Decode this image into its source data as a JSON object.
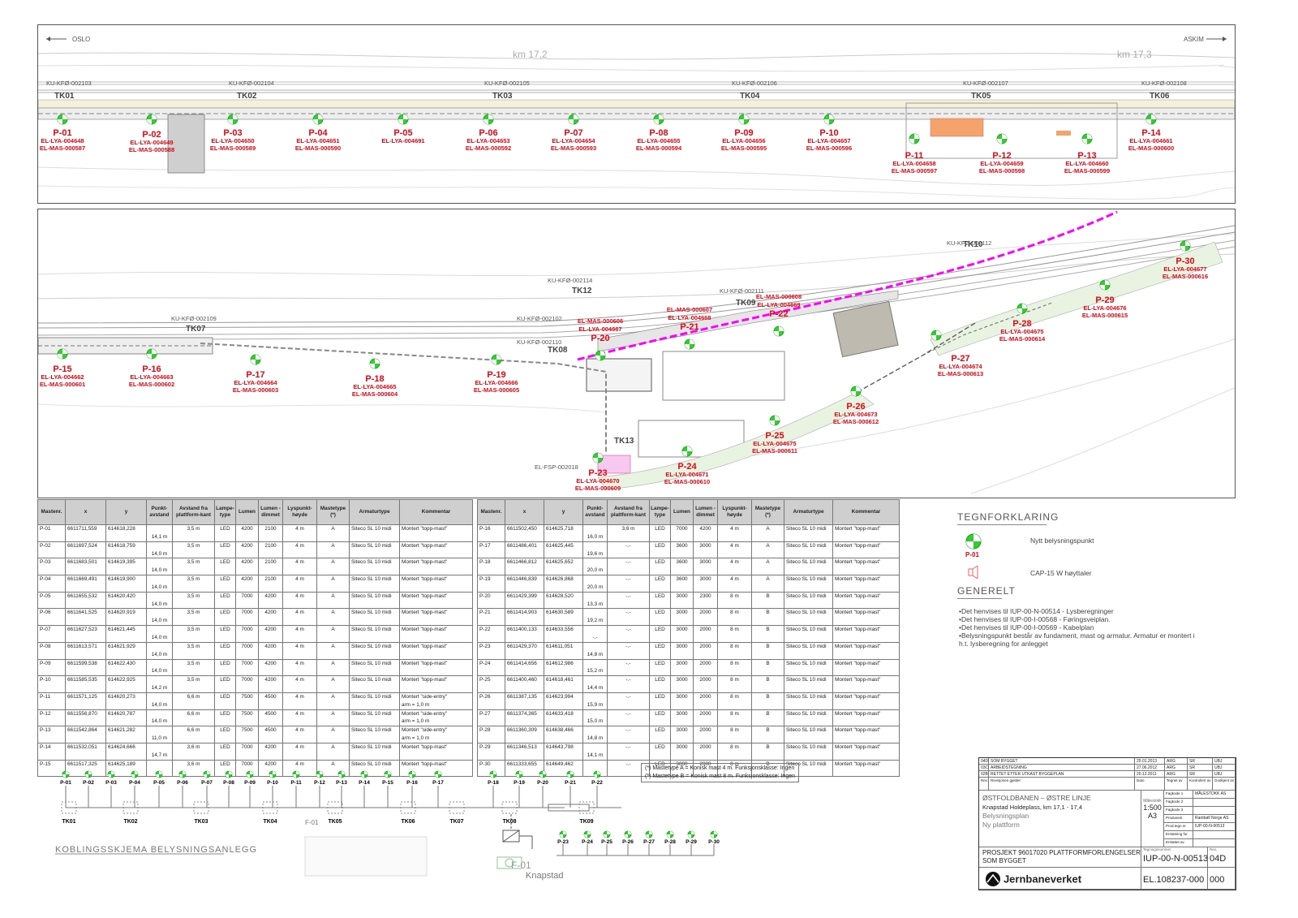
{
  "plan_top": {
    "direction_left": "OSLO",
    "direction_right": "ASKIM",
    "km_labels": [
      "km 17,2",
      "km 17,3"
    ],
    "track_labels": [
      "TK01",
      "TK02",
      "TK03",
      "TK04",
      "TK05",
      "TK06"
    ],
    "ku_labels": [
      "KU-KFØ-002103",
      "KU-KFØ-002104",
      "KU-KFØ-002105",
      "KU-KFØ-002106",
      "KU-KFØ-002107",
      "KU-KFØ-002108"
    ],
    "points": [
      {
        "id": "P-01",
        "lya": "EL-LYA-004648",
        "mas": "EL-MAS-000587"
      },
      {
        "id": "P-02",
        "lya": "EL-LYA-004649",
        "mas": "EL-MAS-000588"
      },
      {
        "id": "P-03",
        "lya": "EL-LYA-004650",
        "mas": "EL-MAS-000589"
      },
      {
        "id": "P-04",
        "lya": "EL-LYA-004651",
        "mas": "EL-MAS-000590"
      },
      {
        "id": "P-05",
        "lya": "EL-LYA-004691",
        "mas": ""
      },
      {
        "id": "P-06",
        "lya": "EL-LYA-004653",
        "mas": "EL-MAS-000592"
      },
      {
        "id": "P-07",
        "lya": "EL-LYA-004654",
        "mas": "EL-MAS-000593"
      },
      {
        "id": "P-08",
        "lya": "EL-LYA-004655",
        "mas": "EL-MAS-000594"
      },
      {
        "id": "P-09",
        "lya": "EL-LYA-004656",
        "mas": "EL-MAS-000595"
      },
      {
        "id": "P-10",
        "lya": "EL-LYA-004657",
        "mas": "EL-MAS-000596"
      },
      {
        "id": "P-11",
        "lya": "EL-LYA-004658",
        "mas": "EL-MAS-000597"
      },
      {
        "id": "P-12",
        "lya": "EL-LYA-004659",
        "mas": "EL-MAS-000598"
      },
      {
        "id": "P-13",
        "lya": "EL-LYA-004660",
        "mas": "EL-MAS-000599"
      },
      {
        "id": "P-14",
        "lya": "EL-LYA-004661",
        "mas": "EL-MAS-000600"
      }
    ]
  },
  "plan_bottom": {
    "track_labels": [
      "TK07",
      "TK08",
      "TK09",
      "TK10",
      "TK12",
      "TK13"
    ],
    "ku_labels": [
      "KU-KFØ-002109",
      "KU-KFØ-002102",
      "KU-KFØ-002110",
      "KU-KFØ-002111",
      "KU-KFØ-002112",
      "KU-KFØ-002114"
    ],
    "fsp_label": "EL-FSP-002018",
    "points": [
      {
        "id": "P-15",
        "lya": "EL-LYA-004662",
        "mas": "EL-MAS-000601"
      },
      {
        "id": "P-16",
        "lya": "EL-LYA-004663",
        "mas": "EL-MAS-000602"
      },
      {
        "id": "P-17",
        "lya": "EL-LYA-004664",
        "mas": "EL-MAS-000603"
      },
      {
        "id": "P-18",
        "lya": "EL-LYA-004665",
        "mas": "EL-MAS-000604"
      },
      {
        "id": "P-19",
        "lya": "EL-LYA-004666",
        "mas": "EL-MAS-000605"
      },
      {
        "id": "P-20",
        "lya": "EL-LYA-004667",
        "mas": "EL-MAS-000606"
      },
      {
        "id": "P-21",
        "lya": "EL-LYA-004668",
        "mas": "EL-MAS-000607"
      },
      {
        "id": "P-22",
        "lya": "EL-LYA-004669",
        "mas": "EL-MAS-000608"
      },
      {
        "id": "P-23",
        "lya": "EL-LYA-004670",
        "mas": "EL-MAS-000609"
      },
      {
        "id": "P-24",
        "lya": "EL-LYA-004671",
        "mas": "EL-MAS-000610"
      },
      {
        "id": "P-25",
        "lya": "EL-LYA-004675",
        "mas": "EL-MAS-000611"
      },
      {
        "id": "P-26",
        "lya": "EL-LYA-004673",
        "mas": "EL-MAS-000612"
      },
      {
        "id": "P-27",
        "lya": "EL-LYA-004674",
        "mas": "EL-MAS-000613"
      },
      {
        "id": "P-28",
        "lya": "EL-LYA-004675",
        "mas": "EL-MAS-000614"
      },
      {
        "id": "P-29",
        "lya": "EL-LYA-004676",
        "mas": "EL-MAS-000615"
      },
      {
        "id": "P-30",
        "lya": "EL-LYA-004677",
        "mas": "EL-MAS-000616"
      }
    ]
  },
  "table_headers": [
    "Mastenr.",
    "x",
    "y",
    "Punkt-avstand",
    "Avstand fra plattform-kant",
    "Lampe-type",
    "Lumen",
    "Lumen - dimmet",
    "Lyspunkt-høyde",
    "Mastetype (*)",
    "Armaturtype",
    "Kommentar"
  ],
  "table_left": [
    {
      "r": [
        "P-01",
        "6611711,559",
        "614618,228",
        "",
        "3,5 m",
        "LED",
        "4200",
        "2100",
        "4 m",
        "A",
        "Siteco SL 10 midi",
        "Montert \"topp-mast\""
      ],
      "d": "14,1 m",
      "c2": ""
    },
    {
      "r": [
        "P-02",
        "6611697,524",
        "614618,759",
        "",
        "3,5 m",
        "LED",
        "4200",
        "2100",
        "4 m",
        "A",
        "Siteco SL 10 midi",
        "Montert \"topp-mast\""
      ],
      "d": "14,0 m",
      "c2": ""
    },
    {
      "r": [
        "P-03",
        "6611683,501",
        "614619,395",
        "",
        "3,5 m",
        "LED",
        "4200",
        "2100",
        "4 m",
        "A",
        "Siteco SL 10 midi",
        "Montert \"topp-mast\""
      ],
      "d": "14,0 m",
      "c2": ""
    },
    {
      "r": [
        "P-04",
        "6611669,491",
        "614619,900",
        "",
        "3,5 m",
        "LED",
        "4200",
        "2100",
        "4 m",
        "A",
        "Siteco SL 10 midi",
        "Montert \"topp-mast\""
      ],
      "d": "14,0 m",
      "c2": ""
    },
    {
      "r": [
        "P-05",
        "6611655,532",
        "614620,420",
        "",
        "3,5 m",
        "LED",
        "7000",
        "4200",
        "4 m",
        "A",
        "Siteco SL 10 midi",
        "Montert \"topp-mast\""
      ],
      "d": "14,0 m",
      "c2": ""
    },
    {
      "r": [
        "P-06",
        "6611641,525",
        "614620,919",
        "",
        "3,5 m",
        "LED",
        "7000",
        "4200",
        "4 m",
        "A",
        "Siteco SL 10 midi",
        "Montert \"topp-mast\""
      ],
      "d": "14,0 m",
      "c2": ""
    },
    {
      "r": [
        "P-07",
        "6611627,523",
        "614621,445",
        "",
        "3,5 m",
        "LED",
        "7000",
        "4200",
        "4 m",
        "A",
        "Siteco SL 10 midi",
        "Montert \"topp-mast\""
      ],
      "d": "14,0 m",
      "c2": ""
    },
    {
      "r": [
        "P-08",
        "6611613,571",
        "614621,929",
        "",
        "3,5 m",
        "LED",
        "7000",
        "4200",
        "4 m",
        "A",
        "Siteco SL 10 midi",
        "Montert \"topp-mast\""
      ],
      "d": "14,0 m",
      "c2": ""
    },
    {
      "r": [
        "P-09",
        "6611599,538",
        "614622,430",
        "",
        "3,5 m",
        "LED",
        "7000",
        "4200",
        "4 m",
        "A",
        "Siteco SL 10 midi",
        "Montert \"topp-mast\""
      ],
      "d": "14,0 m",
      "c2": ""
    },
    {
      "r": [
        "P-10",
        "6611585,535",
        "614622,925",
        "",
        "3,5 m",
        "LED",
        "7000",
        "4200",
        "4 m",
        "A",
        "Siteco SL 10 midi",
        "Montert \"topp-mast\""
      ],
      "d": "14,2 m",
      "c2": ""
    },
    {
      "r": [
        "P-11",
        "6611571,125",
        "614620,273",
        "",
        "6,6 m",
        "LED",
        "7500",
        "4500",
        "4 m",
        "A",
        "Siteco SL 10 midi",
        "Montert \"side-entry\""
      ],
      "d": "14,0 m",
      "c2": "arm = 1,0 m"
    },
    {
      "r": [
        "P-12",
        "6611556,870",
        "614620,787",
        "",
        "6,6 m",
        "LED",
        "7500",
        "4500",
        "4 m",
        "A",
        "Siteco SL 10 midi",
        "Montert \"side-entry\""
      ],
      "d": "14,0 m",
      "c2": "arm = 1,0 m"
    },
    {
      "r": [
        "P-13",
        "6611542,864",
        "614621,282",
        "",
        "6,6 m",
        "LED",
        "7500",
        "4500",
        "4 m",
        "A",
        "Siteco SL 10 midi",
        "Montert \"side-entry\""
      ],
      "d": "11,0 m",
      "c2": "arm = 1,0 m"
    },
    {
      "r": [
        "P-14",
        "6611532,051",
        "614624,666",
        "",
        "3,6 m",
        "LED",
        "7000",
        "4200",
        "4 m",
        "A",
        "Siteco SL 10 midi",
        "Montert \"topp-mast\""
      ],
      "d": "14,7 m",
      "c2": ""
    },
    {
      "r": [
        "P-15",
        "6611517,325",
        "614625,189",
        "",
        "3,6 m",
        "LED",
        "7000",
        "4200",
        "4 m",
        "A",
        "Siteco SL 10 midi",
        "Montert \"topp-mast\""
      ],
      "d": "",
      "c2": ""
    }
  ],
  "table_right": [
    {
      "r": [
        "P-16",
        "6611502,450",
        "614625,718",
        "",
        "3,6 m",
        "LED",
        "7000",
        "4200",
        "4 m",
        "A",
        "Siteco SL 10 midi",
        "Montert \"topp-mast\""
      ],
      "d": "16,0 m",
      "c2": ""
    },
    {
      "r": [
        "P-17",
        "6611486,401",
        "614625,445",
        "",
        "-.-",
        "LED",
        "3600",
        "3000",
        "4 m",
        "A",
        "Siteco SL 10 midi",
        "Montert \"topp-mast\""
      ],
      "d": "19,6 m",
      "c2": ""
    },
    {
      "r": [
        "P-18",
        "6611466,812",
        "614625,652",
        "",
        "-.-",
        "LED",
        "3600",
        "3000",
        "4 m",
        "A",
        "Siteco SL 10 midi",
        "Montert \"topp-mast\""
      ],
      "d": "20,0 m",
      "c2": ""
    },
    {
      "r": [
        "P-19",
        "6611446,839",
        "614626,868",
        "",
        "-.-",
        "LED",
        "3600",
        "3000",
        "4 m",
        "A",
        "Siteco SL 10 midi",
        "Montert \"topp-mast\""
      ],
      "d": "20,0 m",
      "c2": ""
    },
    {
      "r": [
        "P-20",
        "6611429,399",
        "614628,520",
        "",
        "-.-",
        "LED",
        "3000",
        "2300",
        "8 m",
        "B",
        "Siteco SL 10 midi",
        "Montert \"topp-mast\""
      ],
      "d": "13,3 m",
      "c2": ""
    },
    {
      "r": [
        "P-21",
        "6611414,903",
        "614630,589",
        "",
        "-.-",
        "LED",
        "3000",
        "2000",
        "8 m",
        "B",
        "Siteco SL 10 midi",
        "Montert \"topp-mast\""
      ],
      "d": "19,2 m",
      "c2": ""
    },
    {
      "r": [
        "P-22",
        "6611400,133",
        "614633,556",
        "",
        "-.-",
        "LED",
        "3000",
        "2000",
        "8 m",
        "B",
        "Siteco SL 10 midi",
        "Montert \"topp-mast\""
      ],
      "d": "-.-",
      "c2": ""
    },
    {
      "r": [
        "P-23",
        "6611429,370",
        "614611,051",
        "",
        "-.-",
        "LED",
        "3000",
        "2000",
        "8 m",
        "B",
        "Siteco SL 10 midi",
        "Montert \"topp-mast\""
      ],
      "d": "14,8 m",
      "c2": ""
    },
    {
      "r": [
        "P-24",
        "6611414,656",
        "614612,986",
        "",
        "-.-",
        "LED",
        "3000",
        "2000",
        "8 m",
        "B",
        "Siteco SL 10 midi",
        "Montert \"topp-mast\""
      ],
      "d": "15,2 m",
      "c2": ""
    },
    {
      "r": [
        "P-25",
        "6611400,460",
        "614618,461",
        "",
        "-.-",
        "LED",
        "3000",
        "2000",
        "8 m",
        "B",
        "Siteco SL 10 midi",
        "Montert \"topp-mast\""
      ],
      "d": "14,4 m",
      "c2": ""
    },
    {
      "r": [
        "P-26",
        "6611387,135",
        "614623,994",
        "",
        "-.-",
        "LED",
        "3000",
        "2000",
        "8 m",
        "B",
        "Siteco SL 10 midi",
        "Montert \"topp-mast\""
      ],
      "d": "15,9 m",
      "c2": ""
    },
    {
      "r": [
        "P-27",
        "6611374,365",
        "614633,418",
        "",
        "-.-",
        "LED",
        "3000",
        "2000",
        "8 m",
        "B",
        "Siteco SL 10 midi",
        "Montert \"topp-mast\""
      ],
      "d": "15,0 m",
      "c2": ""
    },
    {
      "r": [
        "P-28",
        "6611360,309",
        "614638,466",
        "",
        "-.-",
        "LED",
        "3000",
        "2000",
        "8 m",
        "B",
        "Siteco SL 10 midi",
        "Montert \"topp-mast\""
      ],
      "d": "14,8 m",
      "c2": ""
    },
    {
      "r": [
        "P-29",
        "6611346,513",
        "614643,798",
        "",
        "-.-",
        "LED",
        "3000",
        "2000",
        "8 m",
        "B",
        "Siteco SL 10 midi",
        "Montert \"topp-mast\""
      ],
      "d": "14,1 m",
      "c2": ""
    },
    {
      "r": [
        "P-30",
        "6611333,655",
        "614649,462",
        "",
        "-.-",
        "LED",
        "3000",
        "2000",
        "8 m",
        "B",
        "Siteco SL 10 midi",
        "Montert \"topp-mast\""
      ],
      "d": "",
      "c2": ""
    }
  ],
  "legend": {
    "title": "TEGNFORKLARING",
    "new_point": "Nytt belysningspunkt",
    "sample_id": "P-01",
    "speaker": "CAP-15 W høyttaler",
    "general_title": "GENERELT",
    "general_items": [
      "•Det henvises til IUP-00-N-00514 - Lysberegninger",
      "•Det henvises til IUP-00-I-00568 - Føringsveiplan.",
      "•Det henvises til IUP-00-I-00569 - Kabelplan",
      "•Belysningspunkt består av fundament, mast og armatur. Armatur er montert i",
      "h.t. lysberegning for anlegget"
    ]
  },
  "mast_notes": [
    "(*) Mastetype A = Konisk mast 4 m. Funksjonsklasse: Ingen",
    "(*) Mastetype B = Konisk mast 8 m. Funksjonsklasse: Ingen"
  ],
  "schema": {
    "title": "KOBLINGSSKJEMA BELYSNINGSANLEGG",
    "f01": "F-01",
    "f01b": "F-01",
    "knapstad": "Knapstad",
    "points_row1": [
      "P-01",
      "P-02",
      "P-03",
      "P-04",
      "P-05",
      "P-06",
      "P-07",
      "P-08",
      "P-09",
      "P-10",
      "P-11",
      "P-12",
      "P-13",
      "P-14",
      "P-15",
      "P-16",
      "P-17"
    ],
    "points_row1b": [
      "P-18",
      "P-19",
      "P-20",
      "P-21",
      "P-22"
    ],
    "points_row2": [
      "P-23",
      "P-24",
      "P-25",
      "P-26",
      "P-27",
      "P-28",
      "P-29",
      "P-30"
    ],
    "tks": [
      "TK01",
      "TK02",
      "TK03",
      "TK04",
      "TK05",
      "TK06",
      "TK07",
      "TK08",
      "TK09"
    ]
  },
  "titleblock": {
    "revisions": [
      {
        "rev": "04D",
        "text": "SOM BYGGET",
        "date": "25.01.2013",
        "by": "ARG",
        "ctrl": "SR",
        "app": "UBJ"
      },
      {
        "rev": "03C",
        "text": "ARBEIDSTEGNING",
        "date": "27.06.2012",
        "by": "ARG",
        "ctrl": "SR",
        "app": "UBJ"
      },
      {
        "rev": "02B",
        "text": "RETTET ETTER UTKAST BYGGEPLAN",
        "date": "20.12.2011",
        "by": "ARG",
        "ctrl": "SR",
        "app": "UBJ"
      }
    ],
    "rev_headers": [
      "Rev.",
      "Revisjonen gjelder",
      "Dato",
      "Tegnet av",
      "Kontrollert av",
      "Godkjent av"
    ],
    "line": "ØSTFOLDBANEN  –  ØSTRE  LINJE",
    "place": "Knapstad Holdeplass, km 17,1 - 17,4",
    "subject": "Belysningsplan",
    "subject2": "Ny plattform",
    "scale_label": "Målestokk",
    "scale": "1:500",
    "format": "A3",
    "project": "PROSJEKT 96017020 PLATTFORMFORLENGELSER",
    "project2": "SOM BYGGET",
    "drawing_no": "IUP-00-N-00513",
    "rev": "04D",
    "el_no": "EL.108237-000",
    "el_rev": "000",
    "producer": "Rambøll Norge AS",
    "prod_no": "IUP-00-N-00513",
    "brand": "Jernbaneverket",
    "field_labels": [
      "Fagkode 1",
      "Fagkode 2",
      "Fagkode 3",
      "Produsent",
      "Prod.tegn.nr.",
      "Erstatning for",
      "Erstattet av"
    ],
    "dwg_label": "Tegningsnummer",
    "rev_label": "Rev.",
    "maal_label": "MÅLESTOKK AS"
  },
  "colors": {
    "accent_red": "#e30613",
    "magenta": "#ff00ff",
    "green": "#22aa22"
  }
}
